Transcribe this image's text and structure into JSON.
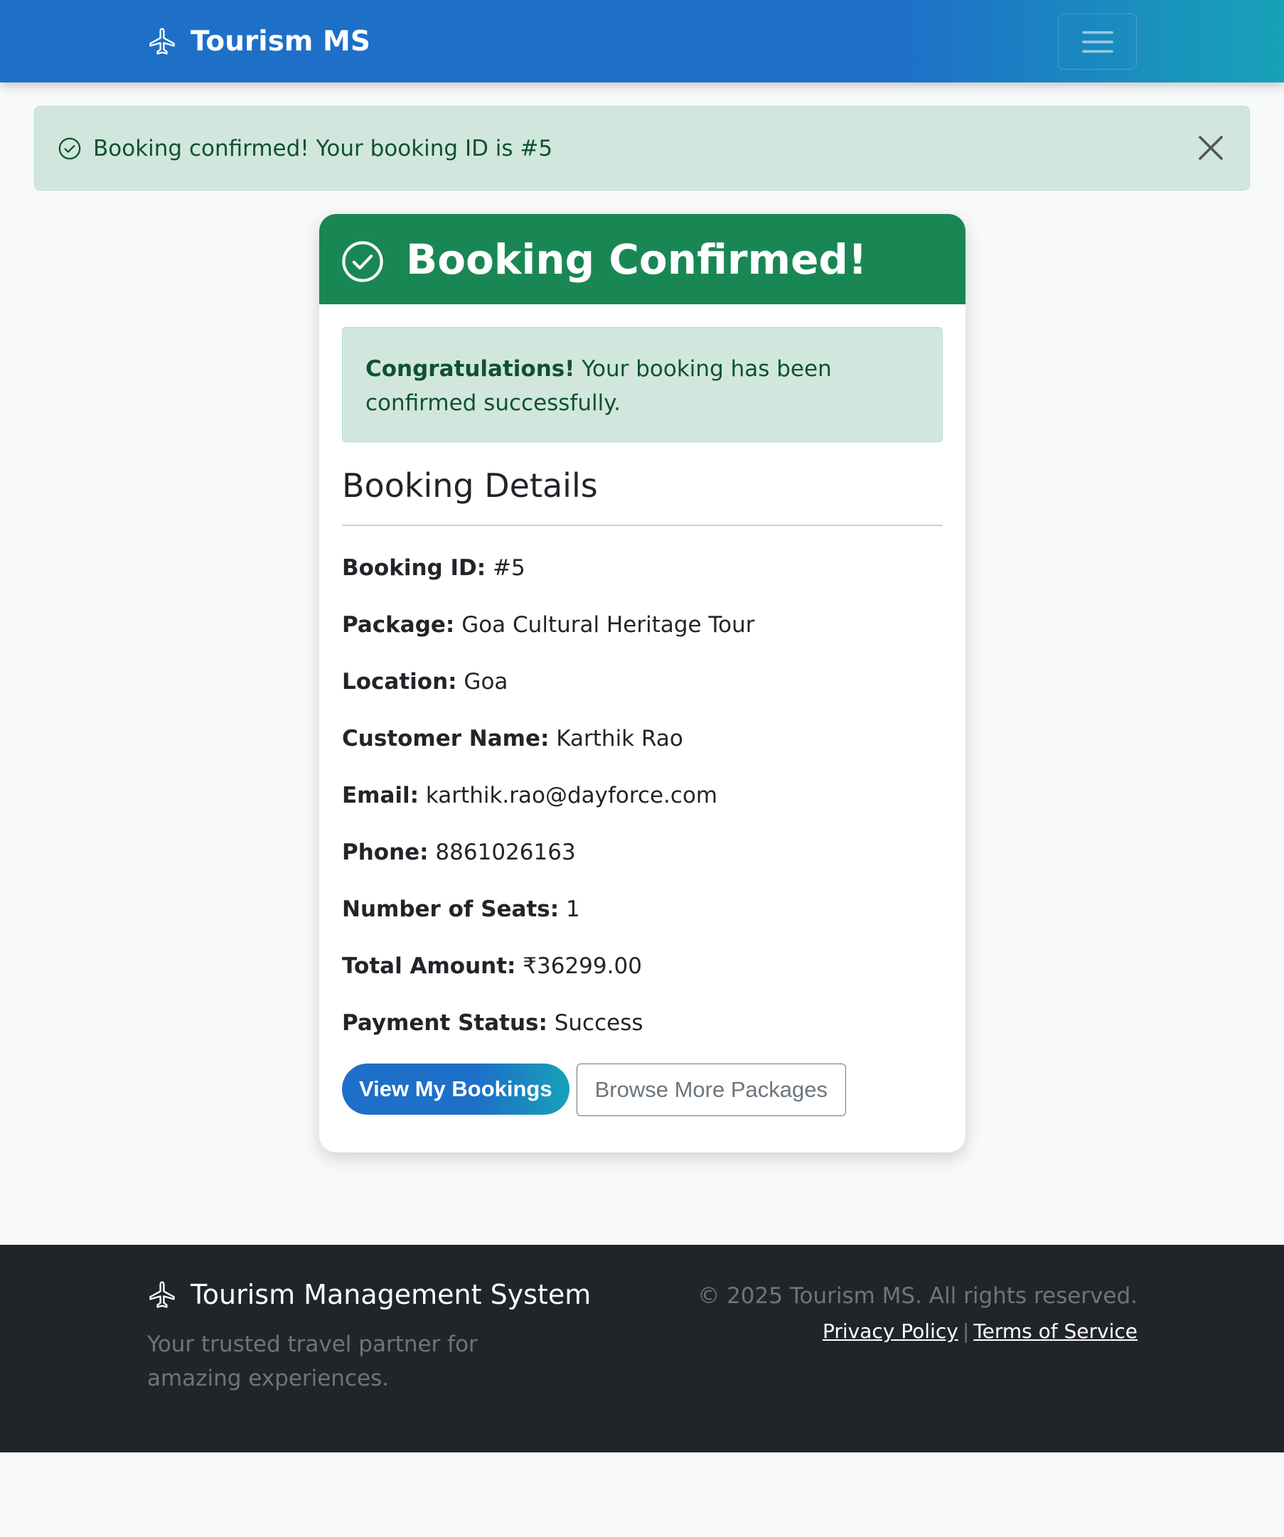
{
  "navbar": {
    "brand": "Tourism MS",
    "brand_icon": "airplane-icon",
    "menu_icon": "hamburger-menu-icon"
  },
  "alert": {
    "icon": "check-circle-icon",
    "message": "Booking confirmed! Your booking ID is #5",
    "close_icon": "close-icon"
  },
  "card": {
    "header_icon": "check-circle-icon",
    "header_title": "Booking Confirmed!",
    "congrats_strong": "Congratulations!",
    "congrats_text": " Your booking has been confirmed successfully.",
    "details_title": "Booking Details",
    "details": [
      {
        "label": "Booking ID:",
        "value": " #5"
      },
      {
        "label": "Package:",
        "value": " Goa Cultural Heritage Tour"
      },
      {
        "label": "Location:",
        "value": " Goa"
      },
      {
        "label": "Customer Name:",
        "value": " Karthik Rao"
      },
      {
        "label": "Email:",
        "value": " karthik.rao@dayforce.com"
      },
      {
        "label": "Phone:",
        "value": " 8861026163"
      },
      {
        "label": "Number of Seats:",
        "value": " 1"
      },
      {
        "label": "Total Amount:",
        "value": " ₹36299.00"
      },
      {
        "label": "Payment Status:",
        "value": " Success"
      }
    ],
    "buttons": {
      "view_bookings": "View My Bookings",
      "browse_packages": "Browse More Packages"
    }
  },
  "footer": {
    "brand": "Tourism Management System",
    "tagline": "Your trusted travel partner for amazing experiences.",
    "copyright": "© 2025 Tourism MS. All rights reserved.",
    "privacy": "Privacy Policy",
    "separator": "|",
    "terms": "Terms of Service"
  },
  "colors": {
    "navbar_start": "#1e6fc8",
    "navbar_end": "#17a2b8",
    "success": "#198754",
    "alert_bg": "#d1e7dd",
    "alert_text": "#0f5132",
    "footer_bg": "#212529"
  }
}
